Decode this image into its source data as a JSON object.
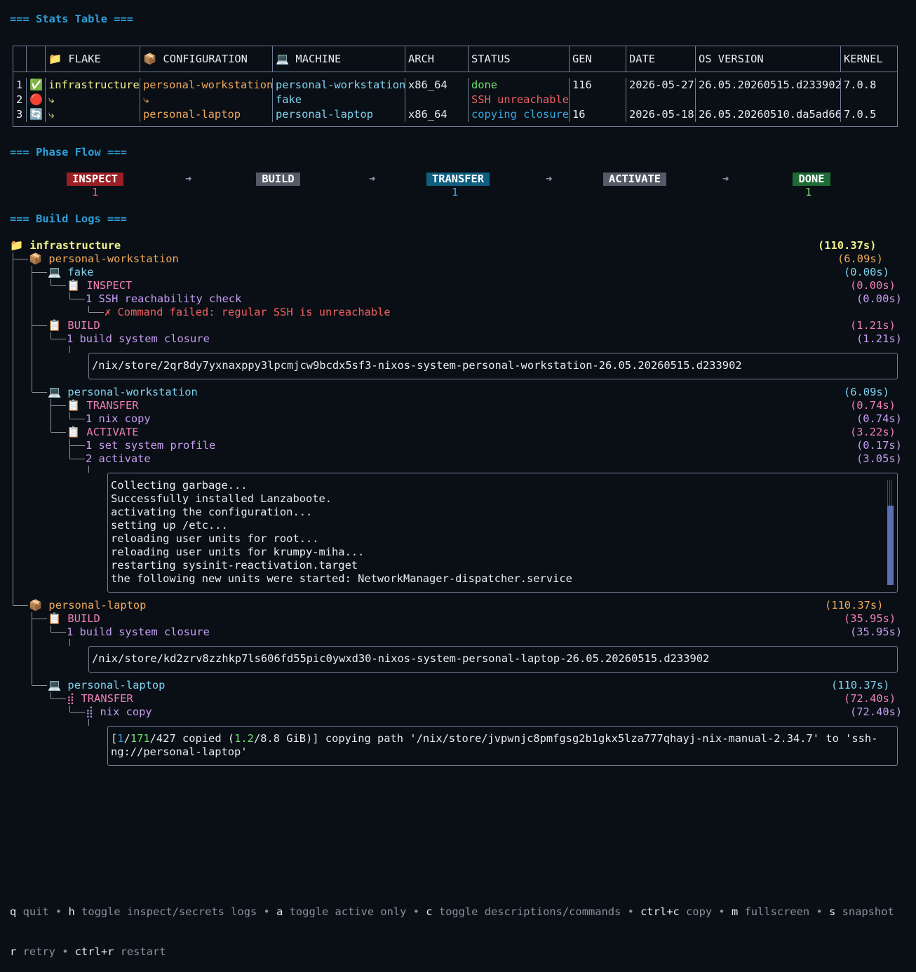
{
  "sections": {
    "stats": "=== Stats Table ===",
    "phase": "=== Phase Flow ===",
    "logs": "=== Build Logs ==="
  },
  "table": {
    "headers": [
      "",
      "",
      "📁 FLAKE",
      "📦 CONFIGURATION",
      "💻 MACHINE",
      "ARCH",
      "STATUS",
      "GEN",
      "DATE",
      "OS VERSION",
      "KERNEL"
    ],
    "rows": [
      {
        "idx": "1",
        "icon": "✅",
        "flake": "infrastructure",
        "config": "personal-workstation",
        "machine": "personal-workstation",
        "arch": "x86_64",
        "status": "done",
        "gen": "116",
        "date": "2026-05-27",
        "os": "26.05.20260515.d233902",
        "kernel": "7.0.8"
      },
      {
        "idx": "2",
        "icon": "🔴",
        "flake": "⤷",
        "config": "⤷",
        "machine": "fake",
        "arch": "",
        "status": "SSH unreachable",
        "gen": "",
        "date": "",
        "os": "",
        "kernel": ""
      },
      {
        "idx": "3",
        "icon": "🔄",
        "flake": "⤷",
        "config": "personal-laptop",
        "machine": "personal-laptop",
        "arch": "x86_64",
        "status": "copying closure",
        "gen": "16",
        "date": "2026-05-18",
        "os": "26.05.20260510.da5ad66",
        "kernel": "7.0.5"
      }
    ]
  },
  "phases": [
    {
      "label": "INSPECT",
      "count": "1",
      "color": "#9b1f24"
    },
    {
      "label": "BUILD",
      "count": "",
      "color": "#555b66"
    },
    {
      "label": "TRANSFER",
      "count": "1",
      "color": "#0f5f80"
    },
    {
      "label": "ACTIVATE",
      "count": "",
      "color": "#555b66"
    },
    {
      "label": "DONE",
      "count": "1",
      "color": "#1f6b35"
    }
  ],
  "phase_arrow": "➜",
  "logs": {
    "root": {
      "label": "📁 infrastructure",
      "time": "(110.37s)"
    },
    "pw": {
      "label": "📦 personal-workstation",
      "time": "(6.09s)"
    },
    "fake": {
      "label": "💻 fake",
      "time": "(0.00s)"
    },
    "fake_inspect": {
      "label": "📋 INSPECT",
      "time": "(0.00s)"
    },
    "fake_ssh": {
      "label": "1 SSH reachability check",
      "time": "(0.00s)"
    },
    "fake_err": "✗ Command failed: regular SSH is unreachable",
    "pw_build": {
      "label": "📋 BUILD",
      "time": "(1.21s)"
    },
    "pw_build_step": {
      "label": "1 build system closure",
      "time": "(1.21s)"
    },
    "pw_build_out": "/nix/store/2qr8dy7yxnaxppy3lpcmjcw9bcdx5sf3-nixos-system-personal-workstation-26.05.20260515.d233902",
    "pw_machine": {
      "label": "💻 personal-workstation",
      "time": "(6.09s)"
    },
    "pw_transfer": {
      "label": "📋 TRANSFER",
      "time": "(0.74s)"
    },
    "pw_nixcopy": {
      "label": "1 nix copy",
      "time": "(0.74s)"
    },
    "pw_activate": {
      "label": "📋 ACTIVATE",
      "time": "(3.22s)"
    },
    "pw_profile": {
      "label": "1 set system profile",
      "time": "(0.17s)"
    },
    "pw_act": {
      "label": "2 activate",
      "time": "(3.05s)"
    },
    "pw_act_out": [
      "Collecting garbage...",
      "Successfully installed Lanzaboote.",
      "activating the configuration...",
      "setting up /etc...",
      "reloading user units for root...",
      "reloading user units for krumpy-miha...",
      "restarting sysinit-reactivation.target",
      "the following new units were started: NetworkManager-dispatcher.service"
    ],
    "pl": {
      "label": "📦 personal-laptop",
      "time": "(110.37s)"
    },
    "pl_build": {
      "label": "📋 BUILD",
      "time": "(35.95s)"
    },
    "pl_build_step": {
      "label": "1 build system closure",
      "time": "(35.95s)"
    },
    "pl_build_out": "/nix/store/kd2zrv8zzhkp7ls606fd55pic0ywxd30-nixos-system-personal-laptop-26.05.20260515.d233902",
    "pl_machine": {
      "label": "💻 personal-laptop",
      "time": "(110.37s)"
    },
    "pl_transfer": {
      "label": "⣾ TRANSFER",
      "time": "(72.40s)"
    },
    "pl_nixcopy": {
      "label": "⣾ nix copy",
      "time": "(72.40s)"
    },
    "pl_copy_prefix": "[",
    "pl_copy_a": "1",
    "pl_copy_sep1": "/",
    "pl_copy_b": "171",
    "pl_copy_mid": "/427 copied (",
    "pl_copy_c": "1.2",
    "pl_copy_rest1": "/8.8 GiB)] copying path '/nix/store/jvpwnjc8pmfgsg2b1gkx5lza777qhayj-nix-manual-2.34.7' to 'ssh-",
    "pl_copy_rest2": "ng://personal-laptop'"
  },
  "statusbar": {
    "line1": [
      {
        "k": "q",
        "d": "quit"
      },
      {
        "k": "h",
        "d": "toggle inspect/secrets logs"
      },
      {
        "k": "a",
        "d": "toggle active only"
      },
      {
        "k": "c",
        "d": "toggle descriptions/commands"
      },
      {
        "k": "ctrl+c",
        "d": "copy"
      },
      {
        "k": "m",
        "d": "fullscreen"
      },
      {
        "k": "s",
        "d": "snapshot"
      }
    ],
    "line2": [
      {
        "k": "r",
        "d": "retry"
      },
      {
        "k": "ctrl+r",
        "d": "restart"
      }
    ],
    "sep": "•"
  }
}
